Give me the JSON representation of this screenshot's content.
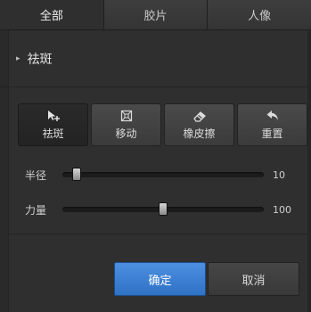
{
  "tabs": [
    {
      "label": "全部",
      "active": true
    },
    {
      "label": "胶片",
      "active": false
    },
    {
      "label": "人像",
      "active": false
    }
  ],
  "section": {
    "caret": "▸",
    "title": "祛斑"
  },
  "tools": [
    {
      "label": "祛斑",
      "icon": "spot-remove-icon",
      "active": true
    },
    {
      "label": "移动",
      "icon": "move-frame-icon",
      "active": false
    },
    {
      "label": "橡皮擦",
      "icon": "eraser-icon",
      "active": false
    },
    {
      "label": "重置",
      "icon": "reset-arrow-icon",
      "active": false
    }
  ],
  "sliders": {
    "radius": {
      "label": "半径",
      "value": "10",
      "fraction": 0.07
    },
    "strength": {
      "label": "力量",
      "value": "100",
      "fraction": 0.5
    }
  },
  "buttons": {
    "ok": "确定",
    "cancel": "取消"
  },
  "colors": {
    "accent": "#3a7fd5",
    "background": "#2f2f2f"
  }
}
